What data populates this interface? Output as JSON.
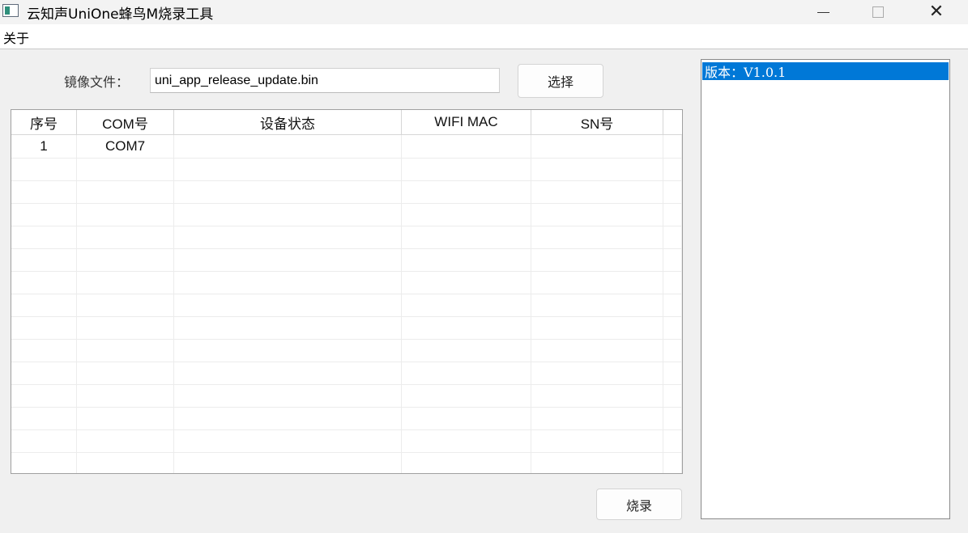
{
  "window": {
    "title": "云知声UniOne蜂鸟M烧录工具",
    "minimize_icon": "minimize-icon",
    "maximize_icon": "maximize-icon",
    "close_icon": "close-icon",
    "close_glyph": "✕"
  },
  "menu": {
    "items": [
      "关于"
    ]
  },
  "file": {
    "label": "镜像文件：",
    "value": "uni_app_release_update.bin",
    "select_label": "选择"
  },
  "table": {
    "columns": [
      "序号",
      "COM号",
      "设备状态",
      "WIFI MAC",
      "SN号"
    ],
    "rows": [
      [
        "1",
        "COM7",
        "",
        "",
        ""
      ]
    ],
    "empty_rows": 14
  },
  "actions": {
    "burn_label": "烧录"
  },
  "log": {
    "lines": [
      "版本：V1.0.1"
    ],
    "highlight_color": "#0078d7"
  }
}
